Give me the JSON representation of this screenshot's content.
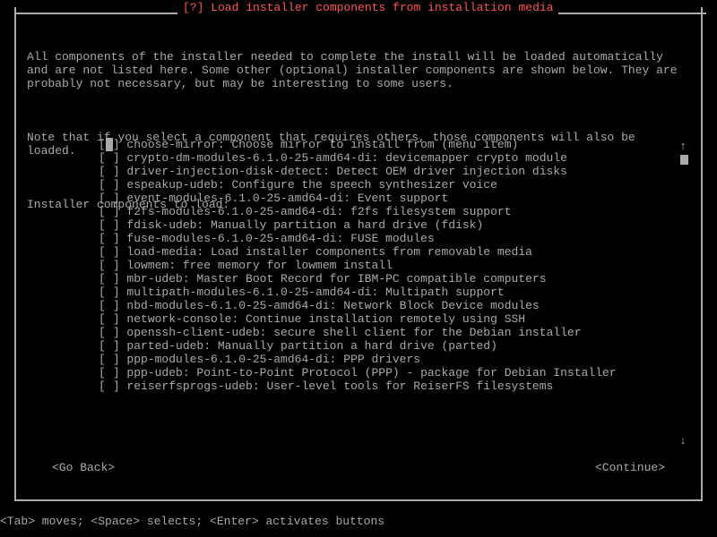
{
  "dialog": {
    "title": "[?] Load installer components from installation media",
    "para1": "All components of the installer needed to complete the install will be loaded automatically and are not listed here. Some other (optional) installer components are shown below. They are probably not necessary, but may be interesting to some users.",
    "para2": "Note that if you select a component that requires others, those components will also be loaded.",
    "prompt": "Installer components to load:",
    "items": [
      {
        "checked": false,
        "focused": true,
        "label": "choose-mirror: Choose mirror to install from (menu item)"
      },
      {
        "checked": false,
        "focused": false,
        "label": "crypto-dm-modules-6.1.0-25-amd64-di: devicemapper crypto module"
      },
      {
        "checked": false,
        "focused": false,
        "label": "driver-injection-disk-detect: Detect OEM driver injection disks"
      },
      {
        "checked": false,
        "focused": false,
        "label": "espeakup-udeb: Configure the speech synthesizer voice"
      },
      {
        "checked": false,
        "focused": false,
        "label": "event-modules-6.1.0-25-amd64-di: Event support"
      },
      {
        "checked": false,
        "focused": false,
        "label": "f2fs-modules-6.1.0-25-amd64-di: f2fs filesystem support"
      },
      {
        "checked": false,
        "focused": false,
        "label": "fdisk-udeb: Manually partition a hard drive (fdisk)"
      },
      {
        "checked": false,
        "focused": false,
        "label": "fuse-modules-6.1.0-25-amd64-di: FUSE modules"
      },
      {
        "checked": false,
        "focused": false,
        "label": "load-media: Load installer components from removable media"
      },
      {
        "checked": false,
        "focused": false,
        "label": "lowmem: free memory for lowmem install"
      },
      {
        "checked": false,
        "focused": false,
        "label": "mbr-udeb: Master Boot Record for IBM-PC compatible computers"
      },
      {
        "checked": false,
        "focused": false,
        "label": "multipath-modules-6.1.0-25-amd64-di: Multipath support"
      },
      {
        "checked": false,
        "focused": false,
        "label": "nbd-modules-6.1.0-25-amd64-di: Network Block Device modules"
      },
      {
        "checked": false,
        "focused": false,
        "label": "network-console: Continue installation remotely using SSH"
      },
      {
        "checked": false,
        "focused": false,
        "label": "openssh-client-udeb: secure shell client for the Debian installer"
      },
      {
        "checked": false,
        "focused": false,
        "label": "parted-udeb: Manually partition a hard drive (parted)"
      },
      {
        "checked": false,
        "focused": false,
        "label": "ppp-modules-6.1.0-25-amd64-di: PPP drivers"
      },
      {
        "checked": false,
        "focused": false,
        "label": "ppp-udeb: Point-to-Point Protocol (PPP) - package for Debian Installer"
      },
      {
        "checked": false,
        "focused": false,
        "label": "reiserfsprogs-udeb: User-level tools for ReiserFS filesystems"
      }
    ],
    "buttons": {
      "back": "<Go Back>",
      "continue": "<Continue>"
    }
  },
  "footer": "<Tab> moves; <Space> selects; <Enter> activates buttons",
  "glyphs": {
    "up": "↑",
    "down": "↓"
  }
}
